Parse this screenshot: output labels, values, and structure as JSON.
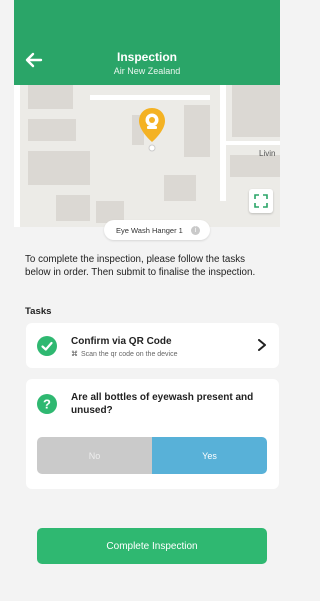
{
  "header": {
    "title": "Inspection",
    "subtitle": "Air New Zealand",
    "back_icon": "arrow-left-icon"
  },
  "map": {
    "street_label": "Livin",
    "location_label": "Eye Wash Hanger 1",
    "pin_icon": "location-pin-icon",
    "expand_icon": "expand-icon",
    "info_icon": "info-icon"
  },
  "instructions": "To complete the inspection, please follow the tasks below in order. Then submit to finalise the inspection.",
  "tasks_heading": "Tasks",
  "tasks": {
    "qr": {
      "title": "Confirm via QR Code",
      "subtitle": "Scan the qr code on the device",
      "status_icon": "check-circle-icon"
    },
    "question": {
      "text": "Are all bottles of eyewash present and unused?",
      "icon": "question-circle-icon",
      "options": [
        "No",
        "Yes"
      ],
      "selected": "Yes"
    }
  },
  "complete_button": "Complete Inspection",
  "colors": {
    "primary_green": "#2aa568",
    "button_green": "#2fb871",
    "yes_blue": "#58b1d8",
    "no_grey": "#cacaca",
    "pin_yellow": "#f4b223"
  }
}
